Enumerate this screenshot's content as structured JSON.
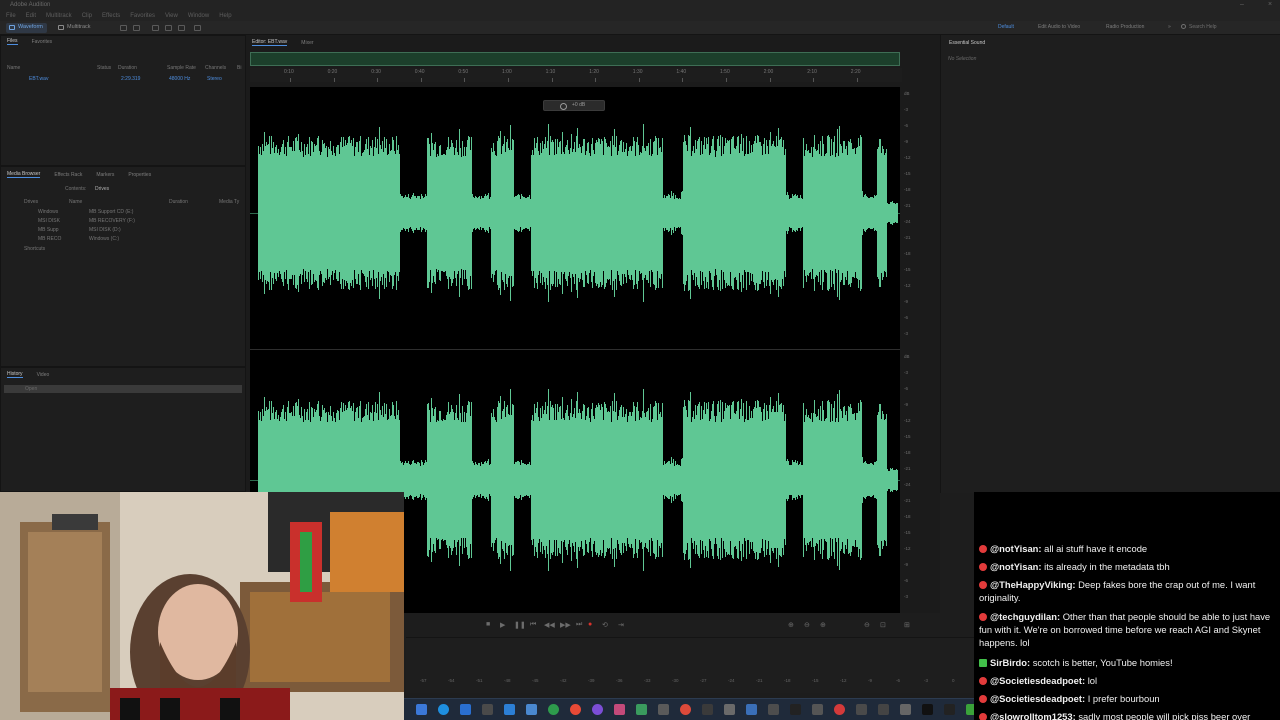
{
  "app": {
    "title": "Adobe Audition",
    "menu": [
      "File",
      "Edit",
      "Multitrack",
      "Clip",
      "Effects",
      "Favorites",
      "View",
      "Window",
      "Help"
    ]
  },
  "toolbar": {
    "waveform_label": "Waveform",
    "multitrack_label": "Multitrack",
    "workspaces": [
      "Default",
      "Edit Audio to Video",
      "Radio Production"
    ],
    "search_placeholder": "Search Help"
  },
  "files_panel": {
    "tabs": [
      "Files",
      "Favorites"
    ],
    "columns": [
      "Name",
      "Status",
      "Duration",
      "Sample Rate",
      "Channels",
      "Bi"
    ],
    "file": {
      "name": "EBT.wav",
      "duration": "2:29.319",
      "sample_rate": "48000 Hz",
      "channels": "Stereo"
    }
  },
  "media_browser": {
    "tabs": [
      "Media Browser",
      "Effects Rack",
      "Markers",
      "Properties"
    ],
    "contents_label": "Contents:",
    "contents_value": "Drives",
    "tree": [
      "Drives",
      "Windows",
      "MSI DISK",
      "MB Supp",
      "MB RECO",
      "Shortcuts"
    ],
    "columns": [
      "Name",
      "Duration",
      "Media Ty"
    ],
    "drives": [
      "MB Support CD (E:)",
      "MB RECOVERY (F:)",
      "MSI DISK (D:)",
      "Windows (C:)"
    ]
  },
  "history_panel": {
    "tabs": [
      "History",
      "Video"
    ],
    "item": "Open"
  },
  "editor": {
    "tabs": [
      "Editor: EBT.wav",
      "Mixer"
    ],
    "hud_value": "+0 dB",
    "ruler": [
      "0:10",
      "0:20",
      "0:30",
      "0:40",
      "0:50",
      "1:00",
      "1:10",
      "1:20",
      "1:30",
      "1:40",
      "1:50",
      "2:00",
      "2:10",
      "2:20"
    ],
    "db_scale": [
      "dB",
      "-3",
      "-6",
      "-9",
      "-12",
      "-15",
      "-18",
      "-21",
      "-24",
      "-21",
      "-18",
      "-15",
      "-12",
      "-9",
      "-6",
      "-3"
    ],
    "waveform_color": "#5fc794"
  },
  "essential_sound": {
    "title": "Essential Sound",
    "status": "No Selection"
  },
  "level_meter": [
    "-57",
    "-54",
    "-51",
    "-48",
    "-45",
    "-42",
    "-39",
    "-36",
    "-33",
    "-30",
    "-27",
    "-24",
    "-21",
    "-18",
    "-15",
    "-12",
    "-9",
    "-6",
    "-3",
    "0"
  ],
  "chat": [
    {
      "badge": "youtube",
      "user": "@notYisan",
      "text": "all ai stuff have it encode"
    },
    {
      "badge": "youtube",
      "user": "@notYisan",
      "text": "its already in the metadata tbh"
    },
    {
      "badge": "youtube",
      "user": "@TheHappyViking",
      "text": "Deep fakes bore the crap out of me. I want originality."
    },
    {
      "badge": "youtube",
      "user": "@techguydilan",
      "text": "Other than that people should be able to just have fun with it. We're on borrowed time before we reach AGI and Skynet happens. lol"
    },
    {
      "badge": "twitch",
      "user": "SirBirdo",
      "text": "scotch is better, YouTube homies!"
    },
    {
      "badge": "youtube",
      "user": "@Societiesdeadpoet",
      "text": "lol"
    },
    {
      "badge": "youtube",
      "user": "@Societiesdeadpoet",
      "text": "I prefer bourboun"
    },
    {
      "badge": "youtube",
      "user": "@slowrolltom1253",
      "text": "sadly most people will pick piss beer over"
    }
  ]
}
